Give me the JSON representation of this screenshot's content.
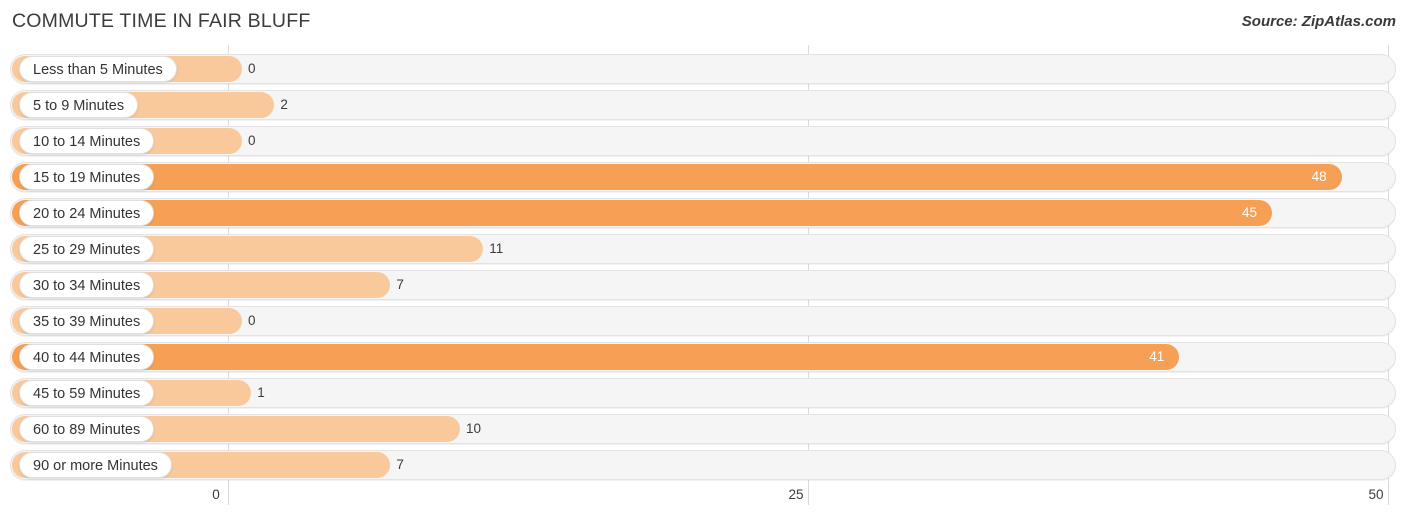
{
  "header": {
    "title": "COMMUTE TIME IN FAIR BLUFF",
    "source": "Source: ZipAtlas.com"
  },
  "chart_data": {
    "type": "bar",
    "orientation": "horizontal",
    "title": "COMMUTE TIME IN FAIR BLUFF",
    "xlabel": "",
    "ylabel": "",
    "xlim": [
      0,
      50
    ],
    "xticks": [
      "0",
      "25",
      "50"
    ],
    "xtick_values": [
      0,
      25,
      50
    ],
    "grid": true,
    "legend": false,
    "accent_color_dark": "#f5a055",
    "accent_color_light": "#f9c99b",
    "track_color": "#f5f5f5",
    "categories": [
      "Less than 5 Minutes",
      "5 to 9 Minutes",
      "10 to 14 Minutes",
      "15 to 19 Minutes",
      "20 to 24 Minutes",
      "25 to 29 Minutes",
      "30 to 34 Minutes",
      "35 to 39 Minutes",
      "40 to 44 Minutes",
      "45 to 59 Minutes",
      "60 to 89 Minutes",
      "90 or more Minutes"
    ],
    "values": [
      0,
      2,
      0,
      48,
      45,
      11,
      7,
      0,
      41,
      1,
      10,
      7
    ],
    "value_labels": [
      "0",
      "2",
      "0",
      "48",
      "45",
      "11",
      "7",
      "0",
      "41",
      "1",
      "10",
      "7"
    ]
  }
}
